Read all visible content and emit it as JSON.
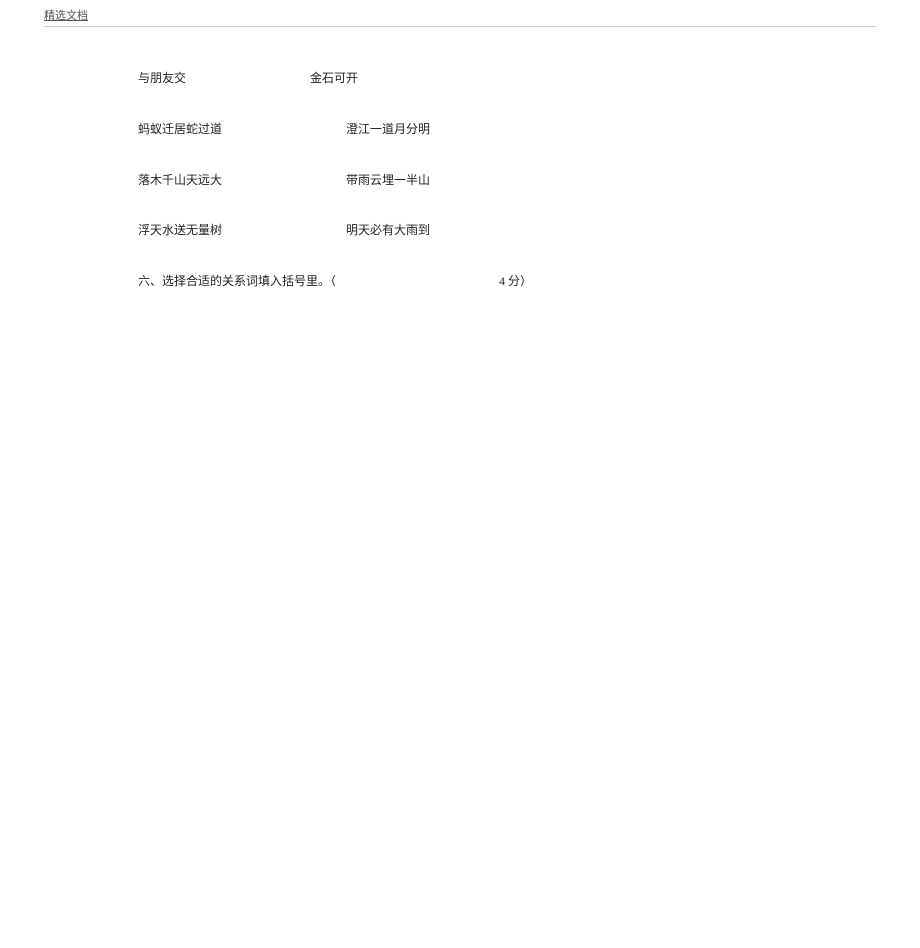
{
  "header": {
    "label": "精选文档"
  },
  "pairs": [
    {
      "left": "与朋友交",
      "right": "金石可开"
    },
    {
      "left": "蚂蚁迁居蛇过道",
      "right": "澄江一道月分明"
    },
    {
      "left": "落木千山天远大",
      "right": "带雨云埋一半山"
    },
    {
      "left": "浮天水送无量树",
      "right": "明天必有大雨到"
    }
  ],
  "question": {
    "prefix": "六、选择合适的关系词填入括号里。（",
    "points": "4 分）"
  }
}
